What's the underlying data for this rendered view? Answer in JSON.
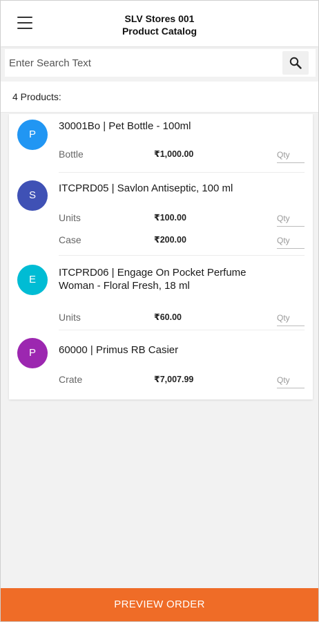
{
  "header": {
    "store_name": "SLV Stores 001",
    "subtitle": "Product Catalog",
    "menu_icon": "hamburger-menu-icon"
  },
  "search": {
    "placeholder": "Enter Search Text",
    "value": "",
    "icon": "search-icon"
  },
  "summary": {
    "count_label": "4  Products:"
  },
  "products": [
    {
      "initial": "P",
      "avatar_color": "#2196F3",
      "name": "30001Bo | Pet Bottle - 100ml",
      "units": [
        {
          "unit": "Bottle",
          "price": "₹1,000.00",
          "qty_placeholder": "Qty"
        }
      ]
    },
    {
      "initial": "S",
      "avatar_color": "#3F51B5",
      "name": "ITCPRD05 | Savlon Antiseptic, 100 ml",
      "units": [
        {
          "unit": "Units",
          "price": "₹100.00",
          "qty_placeholder": "Qty"
        },
        {
          "unit": "Case",
          "price": "₹200.00",
          "qty_placeholder": "Qty"
        }
      ]
    },
    {
      "initial": "E",
      "avatar_color": "#00BCD4",
      "name_line1": "ITCPRD06 | Engage On Pocket Perfume",
      "name_line2": "Woman - Floral Fresh, 18 ml",
      "units": [
        {
          "unit": "Units",
          "price": "₹60.00",
          "qty_placeholder": "Qty"
        }
      ]
    },
    {
      "initial": "P",
      "avatar_color": "#9C27B0",
      "name": "60000 | Primus RB Casier",
      "units": [
        {
          "unit": "Crate",
          "price": "₹7,007.99",
          "qty_placeholder": "Qty"
        }
      ]
    }
  ],
  "footer": {
    "button_label": "PREVIEW ORDER",
    "button_color": "#EF6C27"
  }
}
